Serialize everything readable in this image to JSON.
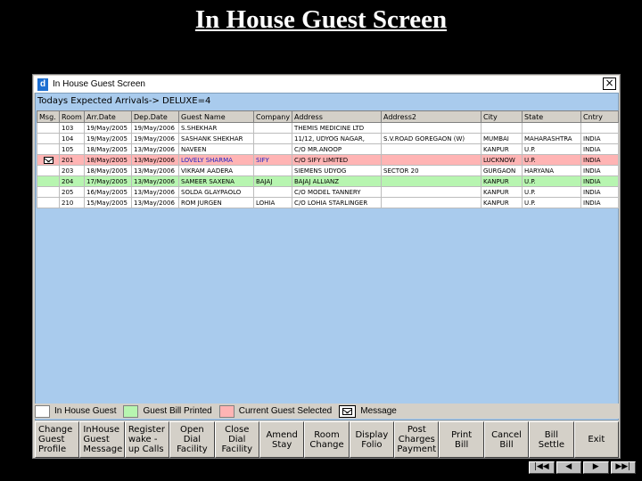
{
  "slide_title": "In House Guest Screen",
  "window": {
    "title": "In House Guest Screen",
    "icon": "app-icon",
    "close_label": "×"
  },
  "arrivals_label": "Todays Expected Arrivals-> DELUXE=4",
  "table": {
    "columns": [
      "Msg.",
      "Room",
      "Arr.Date",
      "Dep.Date",
      "Guest Name",
      "Company",
      "Address",
      "Address2",
      "City",
      "State",
      "Cntry"
    ],
    "rows": [
      {
        "msg": "",
        "room": "103",
        "arr": "19/May/2005",
        "dep": "19/May/2006",
        "guest": "S.SHEKHAR",
        "company": "",
        "address": "THEMIS MEDICINE LTD",
        "address2": "",
        "city": "",
        "state": "",
        "country": "",
        "status": "normal"
      },
      {
        "msg": "",
        "room": "104",
        "arr": "19/May/2005",
        "dep": "19/May/2006",
        "guest": "SASHANK SHEKHAR",
        "company": "",
        "address": "11/12, UDYOG NAGAR,",
        "address2": "S.V.ROAD GOREGAON (W)",
        "city": "MUMBAI",
        "state": "MAHARASHTRA",
        "country": "INDIA",
        "status": "normal"
      },
      {
        "msg": "",
        "room": "105",
        "arr": "18/May/2005",
        "dep": "13/May/2006",
        "guest": "NAVEEN",
        "company": "",
        "address": "C/O MR.ANOOP",
        "address2": "",
        "city": "KANPUR",
        "state": "U.P.",
        "country": "INDIA",
        "status": "normal"
      },
      {
        "msg": "mail-icon",
        "room": "201",
        "arr": "18/May/2005",
        "dep": "13/May/2006",
        "guest": "LOVELY SHARMA",
        "company": "SIFY",
        "address": "C/O SIFY LIMITED",
        "address2": "",
        "city": "LUCKNOW",
        "state": "U.P.",
        "country": "INDIA",
        "status": "selected"
      },
      {
        "msg": "",
        "room": "203",
        "arr": "18/May/2005",
        "dep": "13/May/2006",
        "guest": "VIKRAM AADERA",
        "company": "",
        "address": "SIEMENS UDYOG",
        "address2": "SECTOR 20",
        "city": "GURGAON",
        "state": "HARYANA",
        "country": "INDIA",
        "status": "normal"
      },
      {
        "msg": "",
        "room": "204",
        "arr": "17/May/2005",
        "dep": "13/May/2006",
        "guest": "SAMEER SAXENA",
        "company": "BAJAJ",
        "address": "BAJAJ ALLIANZ",
        "address2": "",
        "city": "KANPUR",
        "state": "U.P.",
        "country": "INDIA",
        "status": "printed"
      },
      {
        "msg": "",
        "room": "205",
        "arr": "16/May/2005",
        "dep": "13/May/2006",
        "guest": "SOLDA GLAYPAOLO",
        "company": "",
        "address": "C/O MODEL TANNERY",
        "address2": "",
        "city": "KANPUR",
        "state": "U.P.",
        "country": "INDIA",
        "status": "normal"
      },
      {
        "msg": "",
        "room": "210",
        "arr": "15/May/2005",
        "dep": "13/May/2006",
        "guest": "ROM JURGEN",
        "company": "LOHIA",
        "address": "C/O LOHIA STARLINGER",
        "address2": "",
        "city": "KANPUR",
        "state": "U.P.",
        "country": "INDIA",
        "status": "normal"
      }
    ]
  },
  "legend": {
    "in_house": "In House Guest",
    "bill_printed": "Guest Bill Printed",
    "selected": "Current Guest Selected",
    "message": "Message",
    "colors": {
      "in_house": "#ffffff",
      "bill_printed": "#b7f5b0",
      "selected": "#ffb4b4"
    }
  },
  "toolbar": [
    {
      "name": "change-guest-profile-button",
      "label": "Change\nGuest\nProfile",
      "align": "left"
    },
    {
      "name": "inhouse-guest-message-button",
      "label": "InHouse\nGuest\nMessage",
      "align": "left"
    },
    {
      "name": "register-wakeup-calls-button",
      "label": "Register\nwake -\nup Calls",
      "align": "left"
    },
    {
      "name": "open-dial-facility-button",
      "label": "Open\nDial\nFacility",
      "align": "center"
    },
    {
      "name": "close-dial-facility-button",
      "label": "Close\nDial\nFacility",
      "align": "center"
    },
    {
      "name": "amend-stay-button",
      "label": "Amend\nStay",
      "align": "center"
    },
    {
      "name": "room-change-button",
      "label": "Room\nChange",
      "align": "center"
    },
    {
      "name": "display-folio-button",
      "label": "Display\nFolio",
      "align": "center"
    },
    {
      "name": "post-charges-payment-button",
      "label": "Post\nCharges\nPayment",
      "align": "center"
    },
    {
      "name": "print-bill-button",
      "label": "Print\nBill",
      "align": "center"
    },
    {
      "name": "cancel-bill-button",
      "label": "Cancel\nBill",
      "align": "center"
    },
    {
      "name": "bill-settle-button",
      "label": "Bill\nSettle",
      "align": "center"
    },
    {
      "name": "exit-button",
      "label": "Exit",
      "align": "center"
    }
  ],
  "nav": [
    {
      "name": "first-slide-button",
      "label": "|◀◀"
    },
    {
      "name": "previous-slide-button",
      "label": "◀"
    },
    {
      "name": "next-slide-button",
      "label": "▶"
    },
    {
      "name": "last-slide-button",
      "label": "▶▶|"
    }
  ]
}
